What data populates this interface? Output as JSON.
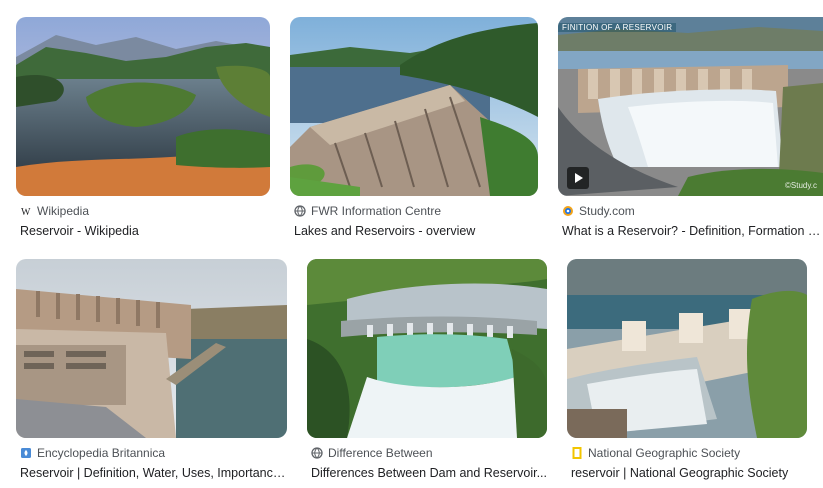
{
  "results": [
    {
      "source": "Wikipedia",
      "favicon": "wikipedia-icon",
      "title": "Reservoir - Wikipedia"
    },
    {
      "source": "FWR Information Centre",
      "favicon": "globe-icon",
      "title": "Lakes and Reservoirs - overview"
    },
    {
      "source": "Study.com",
      "favicon": "study-com-icon",
      "title": "What is a Reservoir? - Definition, Formation & ...",
      "image_caption": "FINITION OF A RESERVOIR",
      "watermark": "©Study.c",
      "has_video": true
    },
    {
      "source": "Encyclopedia Britannica",
      "favicon": "britannica-icon",
      "title": "Reservoir | Definition, Water, Uses, Importance..."
    },
    {
      "source": "Difference Between",
      "favicon": "globe-icon",
      "title": "Differences Between Dam and Reservoir..."
    },
    {
      "source": "National Geographic Society",
      "favicon": "natgeo-icon",
      "title": "reservoir | National Geographic Society"
    }
  ]
}
